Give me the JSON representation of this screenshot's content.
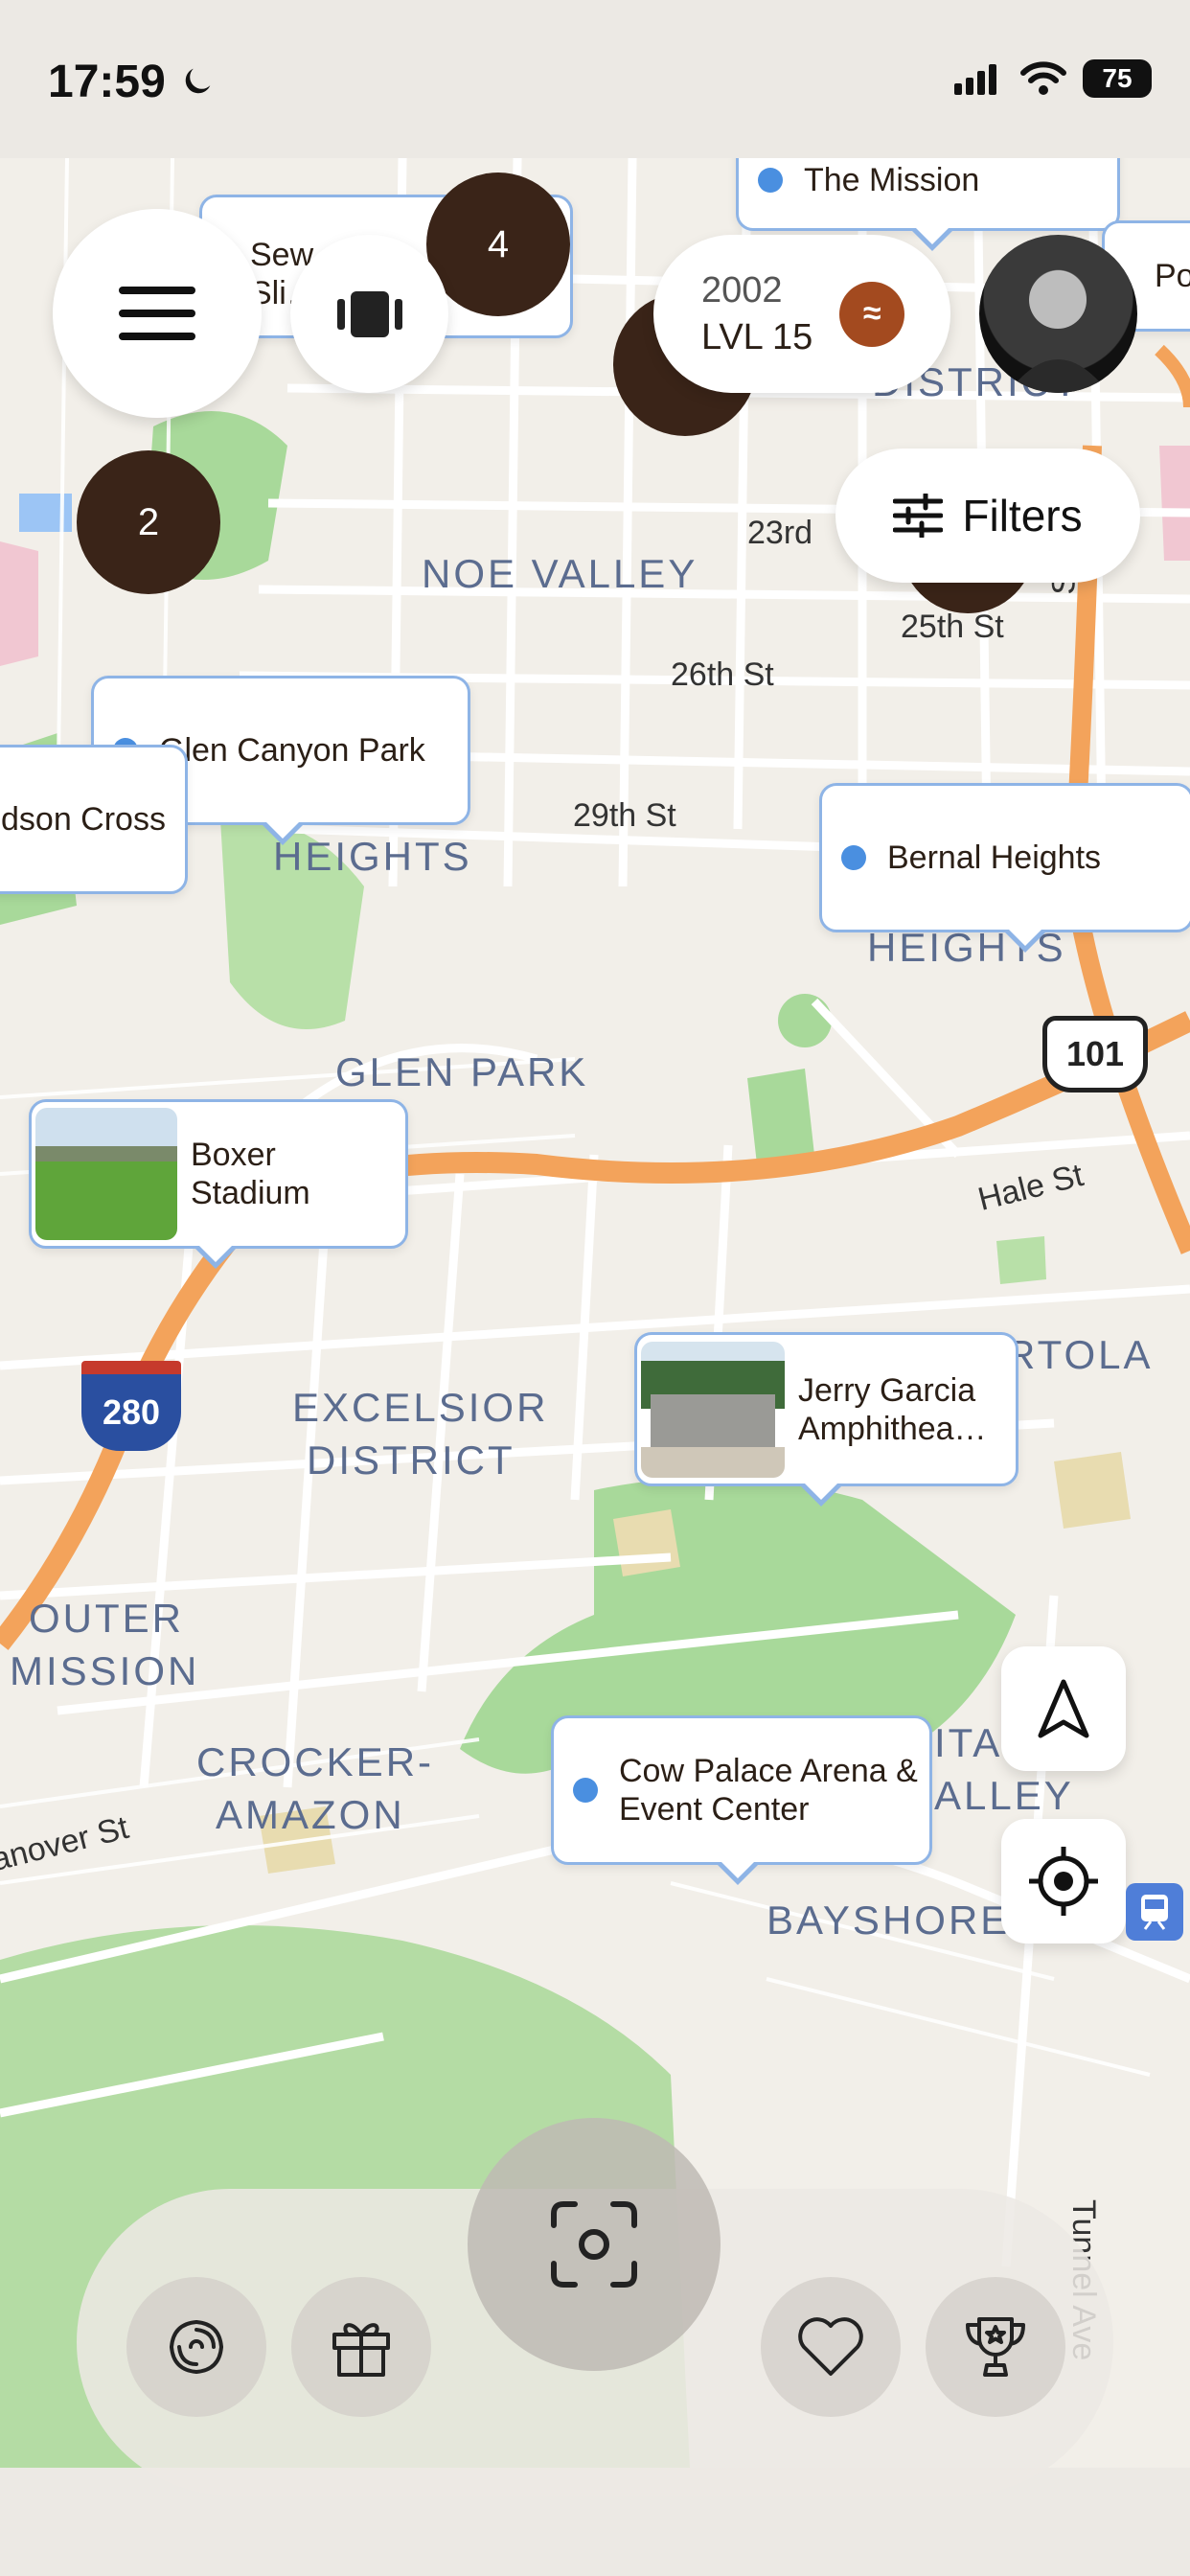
{
  "status_bar": {
    "time": "17:59",
    "battery": "75"
  },
  "header": {
    "cluster_top": "4",
    "cluster_left": "2",
    "sewer_label": "Sew… Sli…",
    "mission_label": "The Mission",
    "xp_value": "2002",
    "level": "LVL 15",
    "partial_label": "Po"
  },
  "filters": {
    "label": "Filters"
  },
  "map": {
    "areas": [
      "NOE VALLEY",
      "HEIGHTS",
      "GLEN PARK",
      "EXCELSIOR",
      "DISTRICT",
      "OUTER",
      "MISSION",
      "CROCKER-",
      "AMAZON",
      "BAYSHORE",
      "HEIGHTS",
      "RTOLA",
      "ALLEY",
      "DISTRICT",
      "ITA"
    ],
    "streets": [
      "23rd",
      "25th St",
      "26th St",
      "29th St",
      "Hale St",
      "anover St",
      "Tunnel Ave",
      "St"
    ],
    "highways": [
      "101",
      "280"
    ]
  },
  "pins": {
    "glen_canyon": "Glen Canyon Park",
    "dson_cross": "dson Cross",
    "bernal": "Bernal Heights",
    "boxer": "Boxer Stadium",
    "jerry": "Jerry Garcia Amphithea…",
    "cow_palace": "Cow Palace Arena & Event Center"
  },
  "colors": {
    "accent": "#4a8fe0",
    "pin_border": "#8eb4e6",
    "cluster": "#3a2418",
    "highway": "#f3a35b",
    "park": "#a8d99a",
    "water": "#9cc5f5"
  }
}
